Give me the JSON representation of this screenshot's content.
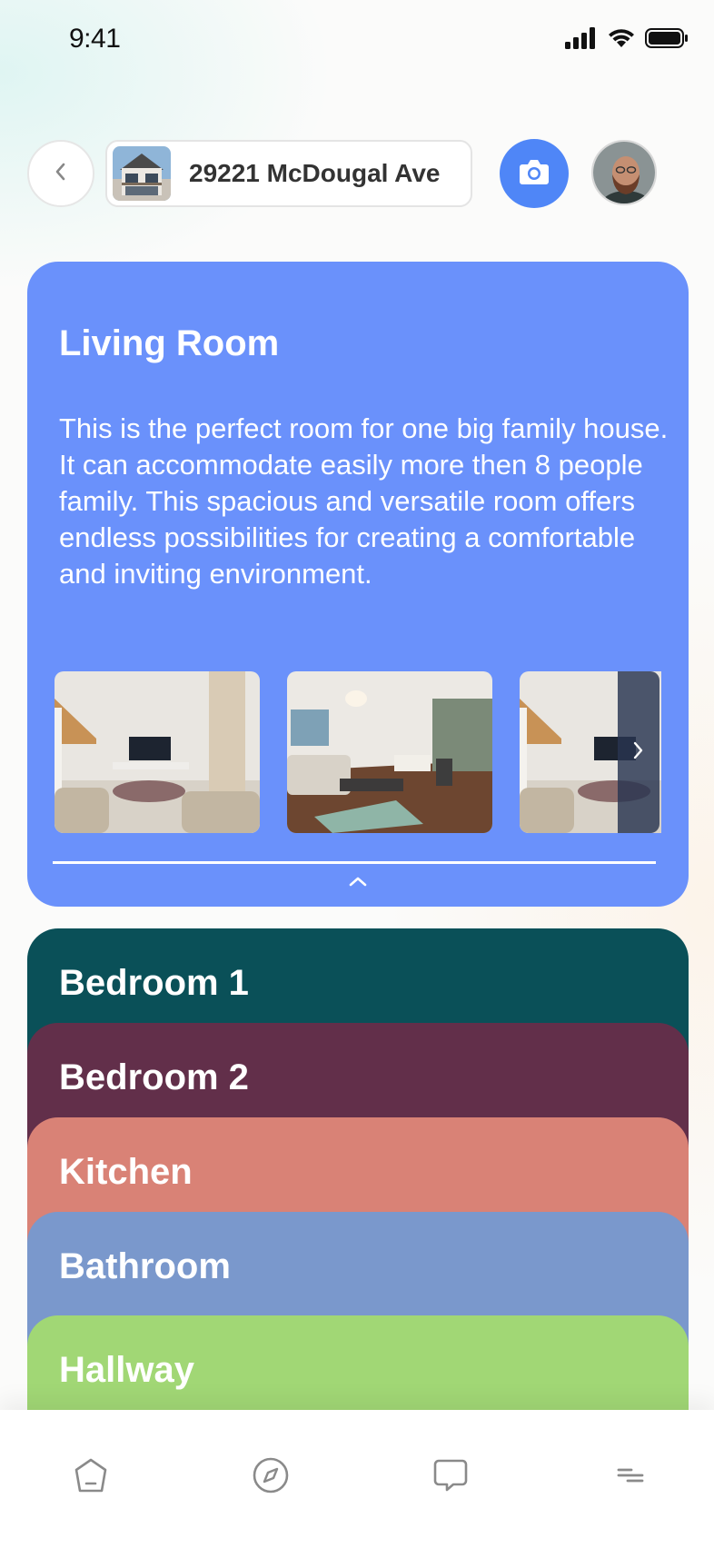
{
  "status_bar": {
    "time": "9:41",
    "icons": [
      "cellular-signal-icon",
      "wifi-icon",
      "battery-icon"
    ]
  },
  "header": {
    "back_icon": "chevron-left-icon",
    "address": "29221 McDougal Ave",
    "camera_icon": "camera-icon",
    "accent_color": "#4f86f7"
  },
  "living_room": {
    "title": "Living Room",
    "description": "This is the perfect room for one big family house. It can accommodate easily more then 8 people family. This spacious and versatile room offers endless possibilities for creating a comfortable and inviting environment.",
    "color": "#6a91fb",
    "gallery_next_icon": "chevron-right-icon",
    "collapse_icon": "chevron-up-icon"
  },
  "rooms": [
    {
      "title": "Bedroom 1",
      "color": "#0a5058"
    },
    {
      "title": "Bedroom 2",
      "color": "#622f4a"
    },
    {
      "title": "Kitchen",
      "color": "#d98276"
    },
    {
      "title": "Bathroom",
      "color": "#7a98cc"
    },
    {
      "title": "Hallway",
      "color": "#a1d775"
    }
  ],
  "bottom_nav": {
    "items": [
      "home-icon",
      "compass-icon",
      "chat-icon",
      "menu-icon"
    ]
  }
}
